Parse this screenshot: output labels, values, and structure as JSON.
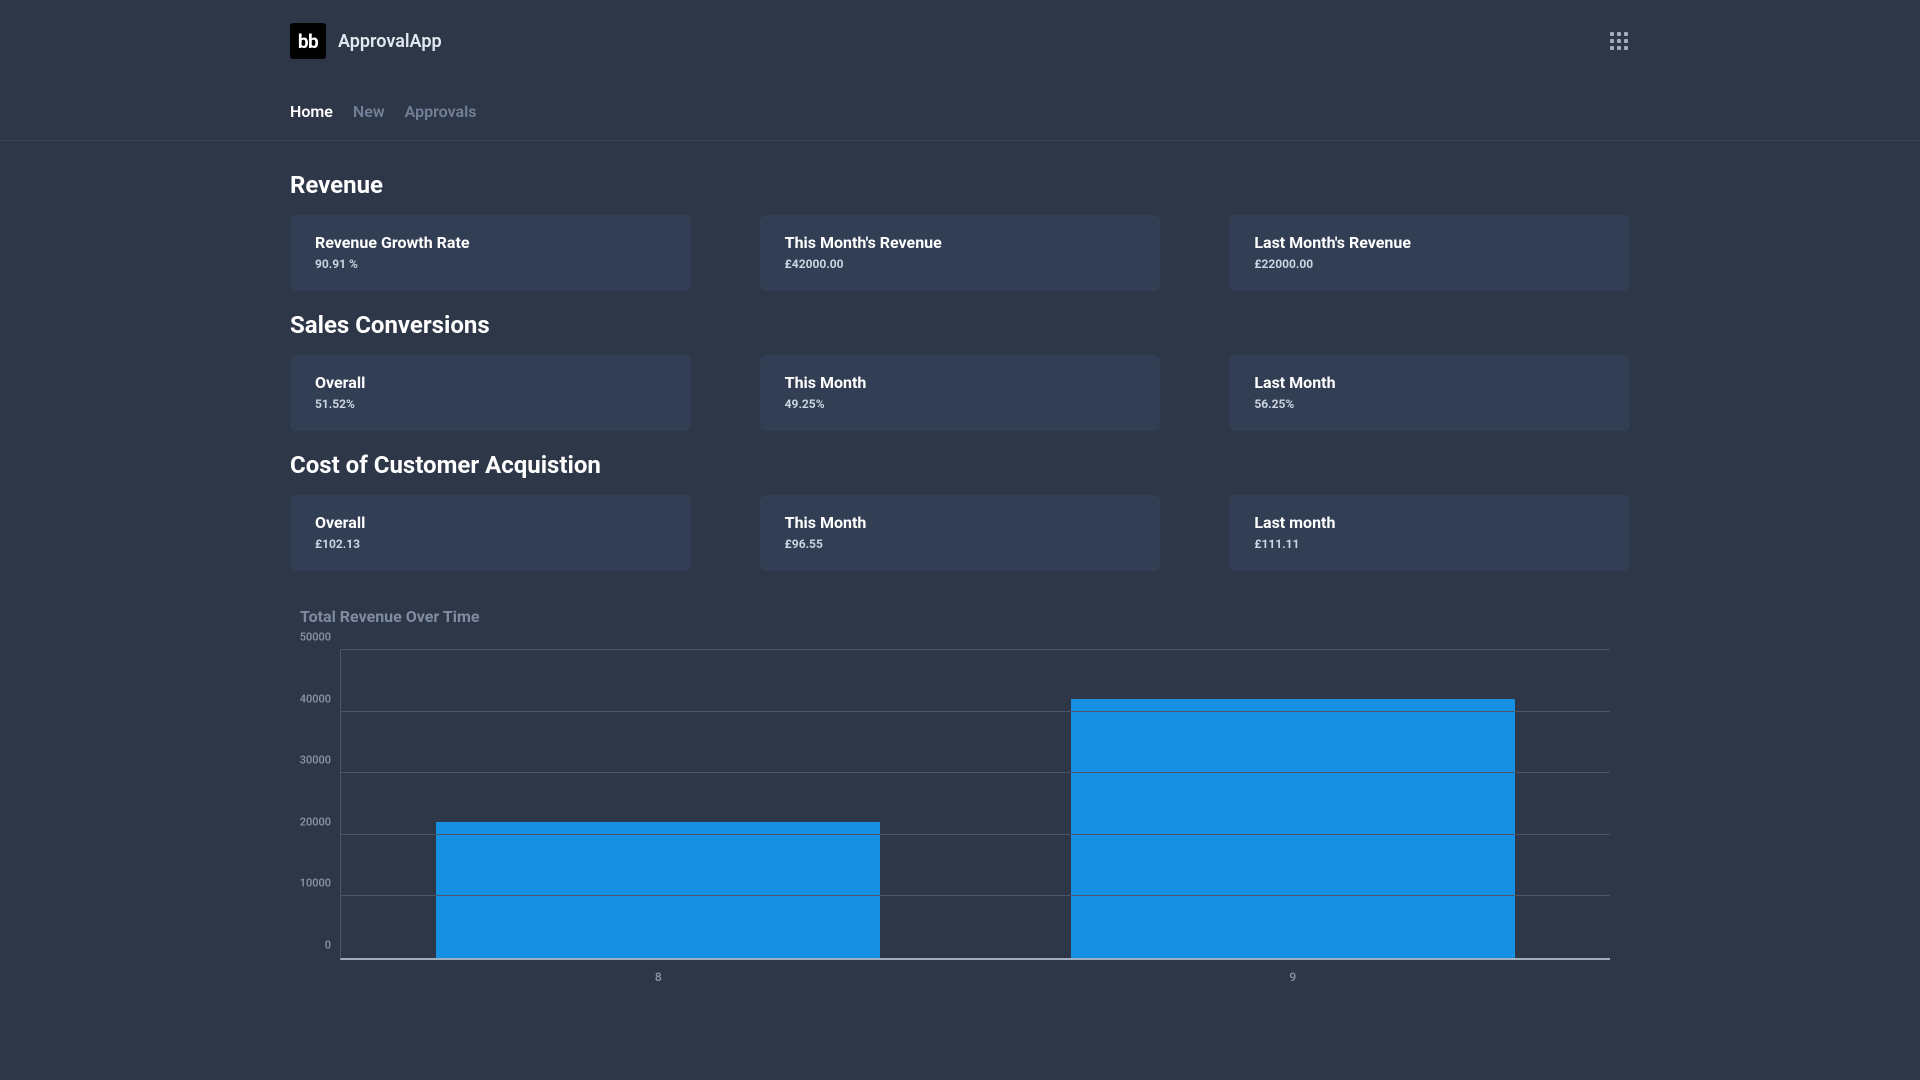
{
  "header": {
    "logo_text": "bb",
    "app_name": "ApprovalApp"
  },
  "nav": {
    "items": [
      {
        "label": "Home",
        "active": true
      },
      {
        "label": "New",
        "active": false
      },
      {
        "label": "Approvals",
        "active": false
      }
    ]
  },
  "sections": {
    "revenue": {
      "title": "Revenue",
      "cards": [
        {
          "title": "Revenue Growth Rate",
          "value": "90.91 %"
        },
        {
          "title": "This Month's Revenue",
          "value": "£42000.00"
        },
        {
          "title": "Last Month's Revenue",
          "value": "£22000.00"
        }
      ]
    },
    "sales": {
      "title": "Sales Conversions",
      "cards": [
        {
          "title": "Overall",
          "value": "51.52%"
        },
        {
          "title": "This Month",
          "value": "49.25%"
        },
        {
          "title": "Last Month",
          "value": "56.25%"
        }
      ]
    },
    "cac": {
      "title": "Cost of Customer Acquistion",
      "cards": [
        {
          "title": "Overall",
          "value": "£102.13"
        },
        {
          "title": "This Month",
          "value": "£96.55"
        },
        {
          "title": "Last month",
          "value": "£111.11"
        }
      ]
    }
  },
  "chart_data": {
    "type": "bar",
    "title": "Total Revenue Over Time",
    "categories": [
      "8",
      "9"
    ],
    "values": [
      22000,
      42000
    ],
    "xlabel": "",
    "ylabel": "",
    "ylim": [
      0,
      50000
    ],
    "yticks": [
      0,
      10000,
      20000,
      30000,
      40000,
      50000
    ],
    "bar_color": "#1690e2"
  }
}
